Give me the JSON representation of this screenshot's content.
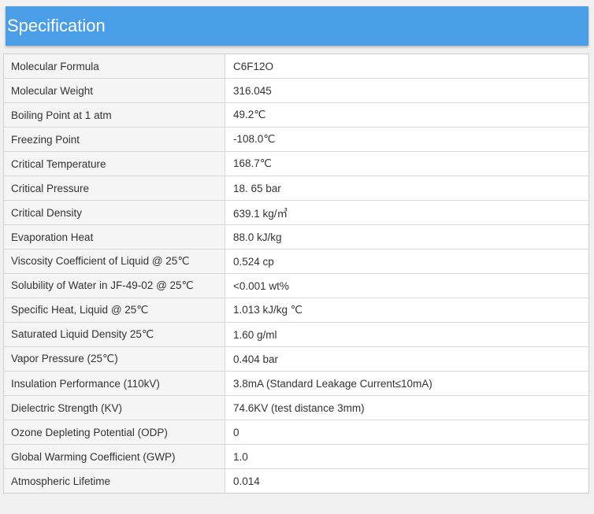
{
  "header": {
    "title": "Specification"
  },
  "specs": [
    {
      "label": "Molecular Formula",
      "value": "C6F12O"
    },
    {
      "label": "Molecular Weight",
      "value": "316.045"
    },
    {
      "label": "Boiling Point at 1 atm",
      "value": "49.2℃"
    },
    {
      "label": "Freezing Point",
      "value": "-108.0℃"
    },
    {
      "label": "Critical Temperature",
      "value": "168.7℃"
    },
    {
      "label": "Critical Pressure",
      "value": "18. 65 bar"
    },
    {
      "label": "Critical Density",
      "value": "639.1 kg/㎥"
    },
    {
      "label": "Evaporation Heat",
      "value": "88.0 kJ/kg"
    },
    {
      "label": "Viscosity Coefficient of Liquid @ 25℃",
      "value": "0.524 cp"
    },
    {
      "label": "Solubility of Water in JF-49-02 @ 25℃",
      "value": "<0.001 wt%"
    },
    {
      "label": "Specific Heat, Liquid @ 25℃",
      "value": "1.013 kJ/kg ℃"
    },
    {
      "label": "Saturated Liquid Density 25℃",
      "value": "1.60 g/ml"
    },
    {
      "label": "Vapor Pressure (25℃)",
      "value": "0.404 bar"
    },
    {
      "label": "Insulation Performance (110kV)",
      "value": "3.8mA (Standard Leakage Current≤10mA)"
    },
    {
      "label": "Dielectric Strength (KV)",
      "value": "74.6KV (test distance 3mm)"
    },
    {
      "label": "Ozone Depleting Potential (ODP)",
      "value": "0"
    },
    {
      "label": "Global Warming Coefficient (GWP)",
      "value": "1.0"
    },
    {
      "label": "Atmospheric Lifetime",
      "value": "0.014"
    }
  ]
}
